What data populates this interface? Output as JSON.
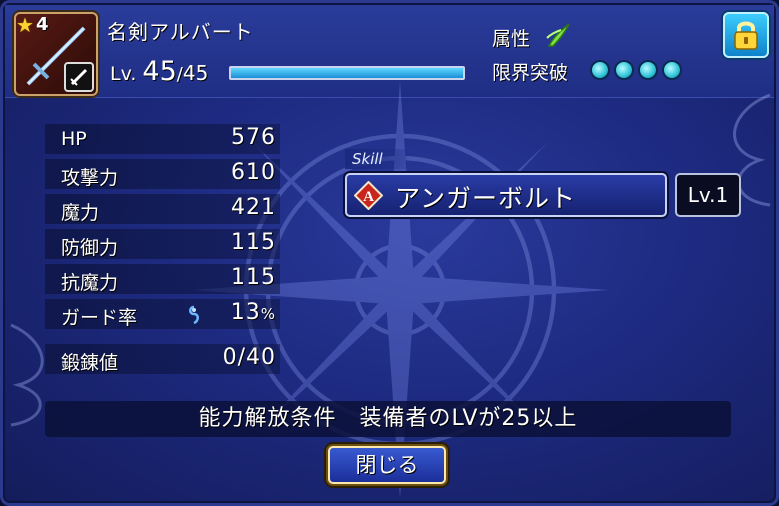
{
  "header": {
    "rarity": "4",
    "item_name": "名剣アルバート",
    "level_label": "Lv.",
    "level_current": "45",
    "level_separator": "/",
    "level_max": "45",
    "level_progress": 1.0,
    "attribute_label": "属性",
    "attribute_icon": "wind-attribute-icon",
    "limit_break_label": "限界突破",
    "limit_break_count": 4,
    "lock_icon": "padlock-icon"
  },
  "stats": [
    {
      "label": "HP",
      "value": "576"
    },
    {
      "label": "攻撃力",
      "value": "610"
    },
    {
      "label": "魔力",
      "value": "421"
    },
    {
      "label": "防御力",
      "value": "115"
    },
    {
      "label": "抗魔力",
      "value": "115"
    },
    {
      "label": "ガード率",
      "value": "13",
      "unit": "%"
    }
  ],
  "forge": {
    "label": "鍛錬値",
    "value": "0/40"
  },
  "skill": {
    "tag": "Skill",
    "name": "アンガーボルト",
    "icon_letter": "A",
    "level": "Lv.1"
  },
  "condition": "能力解放条件　装備者のLVが25以上",
  "close_label": "閉じる",
  "colors": {
    "accent_cyan": "#2ec3d8",
    "exp_bar": "#3fb8f0",
    "panel_blue": "#1d2a80",
    "gold_border": "#ffe9a8"
  }
}
